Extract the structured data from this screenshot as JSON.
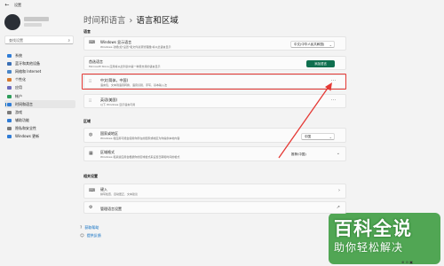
{
  "app": {
    "title": "设置",
    "back_icon": "back-arrow-icon"
  },
  "user": {
    "avatar_icon": "avatar"
  },
  "search": {
    "placeholder": "查找设置"
  },
  "nav": {
    "items": [
      {
        "label": "系统",
        "color": "#2f7cd6"
      },
      {
        "label": "蓝牙和其他设备",
        "color": "#3a6fb5"
      },
      {
        "label": "网络和 Internet",
        "color": "#4a86c7"
      },
      {
        "label": "个性化",
        "color": "#d67a2f"
      },
      {
        "label": "应用",
        "color": "#6b6bbd"
      },
      {
        "label": "帐户",
        "color": "#2e9d5a"
      },
      {
        "label": "时间和语言",
        "color": "#2f7cd6",
        "active": true
      },
      {
        "label": "游戏",
        "color": "#7b7b7b"
      },
      {
        "label": "辅助功能",
        "color": "#2f7cd6"
      },
      {
        "label": "隐私和安全性",
        "color": "#7b7b7b"
      },
      {
        "label": "Windows 更新",
        "color": "#2f7cd6"
      }
    ]
  },
  "breadcrumb": {
    "parent": "时间和语言",
    "separator": "›",
    "current": "语言和区域"
  },
  "language": {
    "section_label": "语言",
    "display": {
      "title": "Windows 显示语言",
      "desc": "Windows 功能(如\"设置\"和文件资源管理器)将以此语言显示",
      "value": "中文(中华人民共和国)"
    },
    "preferred": {
      "title": "首选语言",
      "desc": "Microsoft Store 应用将以此列表中第一种受支持的语言显示",
      "button": "添加语言"
    },
    "items": [
      {
        "title": "中文(简体，中国)",
        "desc": "语言包、文本到语音转换、语音识别、手写、基本输入法"
      },
      {
        "title": "英语(美国)",
        "desc": "以下 Windows 显示语言可用"
      }
    ]
  },
  "region": {
    "section_label": "区域",
    "country": {
      "title": "国家或地区",
      "desc": "Windows 和应用可能会使用你所在的国家或地区为你提供本地内容",
      "value": "中国"
    },
    "format": {
      "title": "区域格式",
      "desc": "Windows 和某些应用会根据你的区域格式来设置日期和时间的格式",
      "value": "推荐(中国)"
    }
  },
  "related": {
    "section_label": "相关设置",
    "items": [
      {
        "title": "键入",
        "desc": "拼写检查、自动更正、文本建议"
      },
      {
        "title": "管理语言设置"
      }
    ]
  },
  "help": {
    "get_help": "获取帮助",
    "feedback": "提供反馈"
  },
  "watermark": {
    "main": "百科全说",
    "sub": "助你轻松解决"
  },
  "annotation": {
    "highlight_color": "#e53935",
    "arrow_color": "#e53935"
  }
}
